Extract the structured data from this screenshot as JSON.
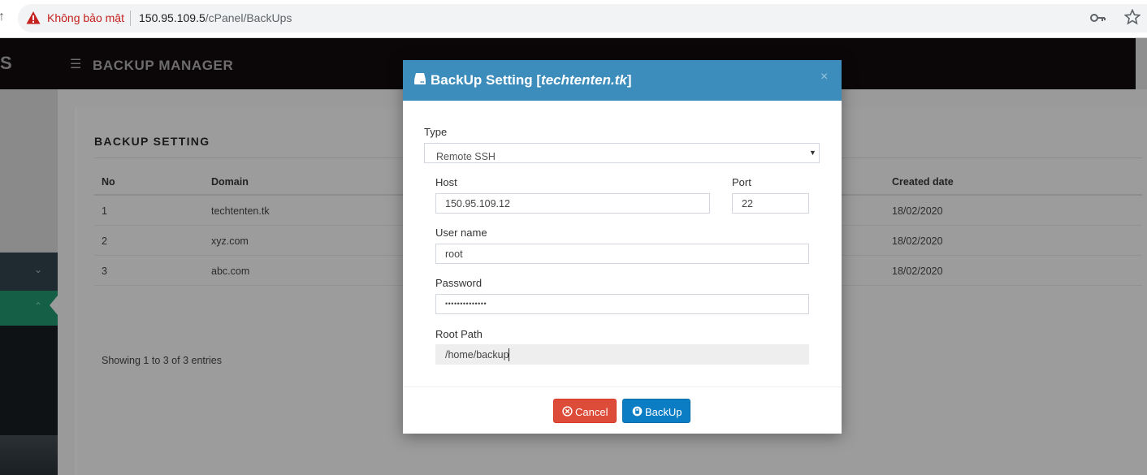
{
  "browser": {
    "security_label": "Không bảo mật",
    "url_host": "150.95.109.5",
    "url_path": "/cPanel/BackUps"
  },
  "header": {
    "logo_fragment": "S",
    "title": "BACKUP MANAGER"
  },
  "panel": {
    "title": "BACKUP SETTING",
    "columns": {
      "no": "No",
      "domain": "Domain",
      "created": "Created date"
    },
    "rows": [
      {
        "no": "1",
        "domain": "techtenten.tk",
        "created": "18/02/2020"
      },
      {
        "no": "2",
        "domain": "xyz.com",
        "created": "18/02/2020"
      },
      {
        "no": "3",
        "domain": "abc.com",
        "created": "18/02/2020"
      }
    ],
    "info": "Showing 1 to 3 of 3 entries"
  },
  "modal": {
    "title_prefix": "BackUp Setting [",
    "title_domain": "techtenten.tk",
    "title_suffix": "]",
    "close": "×",
    "type_label": "Type",
    "type_value": "Remote SSH",
    "host_label": "Host",
    "host_value": "150.95.109.12",
    "port_label": "Port",
    "port_value": "22",
    "username_label": "User name",
    "username_value": "root",
    "password_label": "Password",
    "password_value": "••••••••••••••",
    "rootpath_label": "Root Path",
    "rootpath_value": "/home/backup",
    "cancel_label": "Cancel",
    "backup_label": "BackUp"
  },
  "colors": {
    "modal_header": "#3c8dbc",
    "cancel": "#dd4b39",
    "backup": "#0b7dc4",
    "insecure": "#c5221f"
  },
  "icons": [
    "back-arrow-icon",
    "warning-icon",
    "key-icon",
    "star-icon",
    "hamburger-icon",
    "hard-drive-icon",
    "close-icon",
    "chevron-down-icon",
    "chevron-up-icon",
    "cancel-circle-icon",
    "backup-icon"
  ]
}
